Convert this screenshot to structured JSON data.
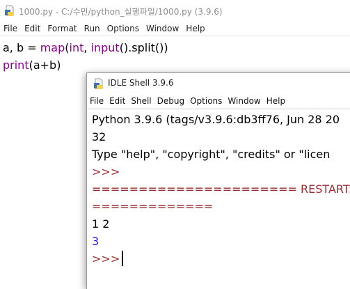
{
  "editor": {
    "title": "1000.py - C:/수민/python_실행파일/1000.py (3.9.6)",
    "menu": [
      "File",
      "Edit",
      "Format",
      "Run",
      "Options",
      "Window",
      "Help"
    ],
    "code_line1": {
      "a": "a, b = ",
      "map": "map",
      "paren1": "(",
      "int": "int",
      "comma": ", ",
      "input": "input",
      "rest": "().split())"
    },
    "code_line2": {
      "print": "print",
      "rest": "(a+b)"
    }
  },
  "shell": {
    "title": "IDLE Shell 3.9.6",
    "menu": [
      "File",
      "Edit",
      "Shell",
      "Debug",
      "Options",
      "Window",
      "Help"
    ],
    "lines": {
      "banner1": "Python 3.9.6 (tags/v3.9.6:db3ff76, Jun 28 20",
      "banner2": "32",
      "banner3": "Type \"help\", \"copyright\", \"credits\" or \"licen",
      "prompt1": ">>>",
      "restart1": "====================== RESTART:",
      "restart2": "=============",
      "input": "1 2",
      "output": "3",
      "prompt2": ">>>"
    }
  },
  "colors": {
    "keyword": "#900090",
    "output": "#1a1aff",
    "prompt": "#9a2c2c"
  }
}
